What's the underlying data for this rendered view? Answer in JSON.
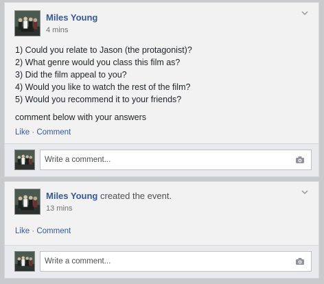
{
  "posts": [
    {
      "author": "Miles Young",
      "action": "",
      "time": "4 mins",
      "questions": [
        "1) Could you relate to Jason (the protagonist)?",
        "2) What genre would you class this film as?",
        "3) Did the film appeal to you?",
        "4) Would you like to watch the rest of the film?",
        "5) Would you recommend it to your friends?"
      ],
      "cta": "comment below with your answers",
      "like_label": "Like",
      "separator": "·",
      "comment_label": "Comment",
      "comment_placeholder": "Write a comment...",
      "options_icon": "chevron-down-icon",
      "camera_icon": "camera-icon"
    },
    {
      "author": "Miles Young",
      "action": "created the event.",
      "time": "13 mins",
      "like_label": "Like",
      "separator": "·",
      "comment_label": "Comment",
      "comment_placeholder": "Write a comment...",
      "options_icon": "chevron-down-icon",
      "camera_icon": "camera-icon"
    }
  ],
  "colors": {
    "link": "#365899",
    "card": "#f2f2f2",
    "comment_bg": "#e9eaed",
    "page_bg": "#c9cacc"
  }
}
